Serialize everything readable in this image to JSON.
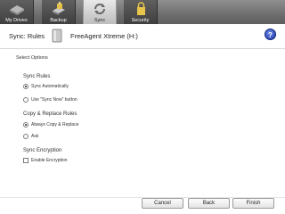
{
  "tabs": [
    {
      "label": "My Drives",
      "icon": "drives-icon",
      "active": false
    },
    {
      "label": "Backup",
      "icon": "backup-icon",
      "active": false
    },
    {
      "label": "Sync",
      "icon": "sync-icon",
      "active": true
    },
    {
      "label": "Security",
      "icon": "security-icon",
      "active": false
    }
  ],
  "header": {
    "title": "Sync: Rules",
    "drive_name": "FreeAgent Xtreme (H:)",
    "help_label": "?"
  },
  "section_title": "Select Options",
  "sync_rules": {
    "heading": "Sync Rules",
    "options": [
      {
        "label": "Sync Automatically",
        "selected": true
      },
      {
        "label": "Use \"Sync Now\" button",
        "selected": false
      }
    ]
  },
  "copy_replace": {
    "heading": "Copy & Replace Rules",
    "options": [
      {
        "label": "Always Copy & Replace",
        "selected": true
      },
      {
        "label": "Ask",
        "selected": false
      }
    ]
  },
  "encryption": {
    "heading": "Sync Encryption",
    "checkbox_label": "Enable Encryption",
    "checked": false
  },
  "buttons": {
    "cancel": "Cancel",
    "back": "Back",
    "finish": "Finish"
  },
  "colors": {
    "tab_dark": "#4a4a4a",
    "tab_active": "#d9d9d9",
    "help_blue": "#2a48c0"
  }
}
